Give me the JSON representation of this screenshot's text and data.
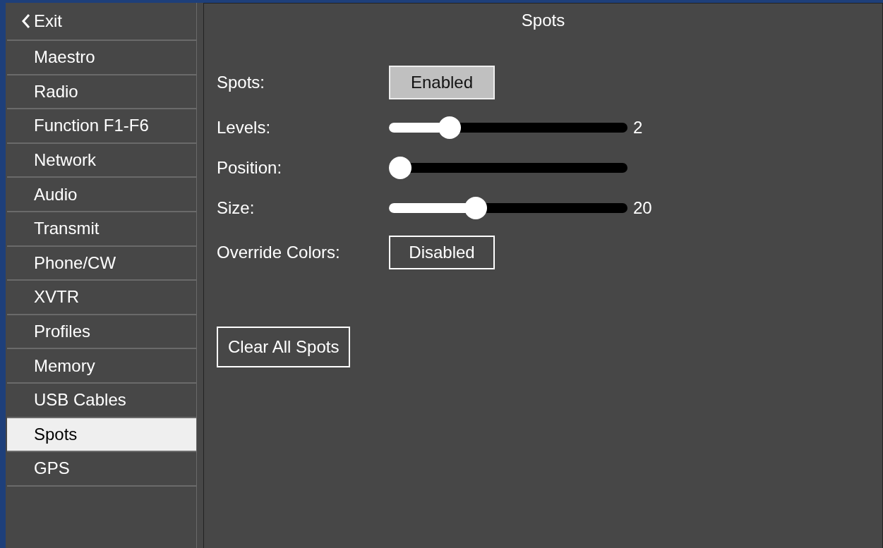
{
  "sidebar": {
    "back": {
      "label": "Exit"
    },
    "items": [
      {
        "label": "Maestro",
        "selected": false
      },
      {
        "label": "Radio",
        "selected": false
      },
      {
        "label": "Function F1-F6",
        "selected": false
      },
      {
        "label": "Network",
        "selected": false
      },
      {
        "label": "Audio",
        "selected": false
      },
      {
        "label": "Transmit",
        "selected": false
      },
      {
        "label": "Phone/CW",
        "selected": false
      },
      {
        "label": "XVTR",
        "selected": false
      },
      {
        "label": "Profiles",
        "selected": false
      },
      {
        "label": "Memory",
        "selected": false
      },
      {
        "label": "USB Cables",
        "selected": false
      },
      {
        "label": "Spots",
        "selected": true
      },
      {
        "label": "GPS",
        "selected": false
      }
    ]
  },
  "panel": {
    "title": "Spots",
    "settings": [
      {
        "kind": "toggle",
        "label": "Spots:",
        "value": "Enabled",
        "on": true
      },
      {
        "kind": "slider",
        "label": "Levels:",
        "level": 0.23,
        "reading": "2"
      },
      {
        "kind": "slider",
        "label": "Position:",
        "level": 0
      },
      {
        "kind": "slider",
        "label": "Size:",
        "level": 0.35,
        "reading": "20"
      },
      {
        "kind": "toggle",
        "label": "Override Colors:",
        "value": "Disabled",
        "on": false
      }
    ],
    "clear_button": "Clear All Spots"
  }
}
